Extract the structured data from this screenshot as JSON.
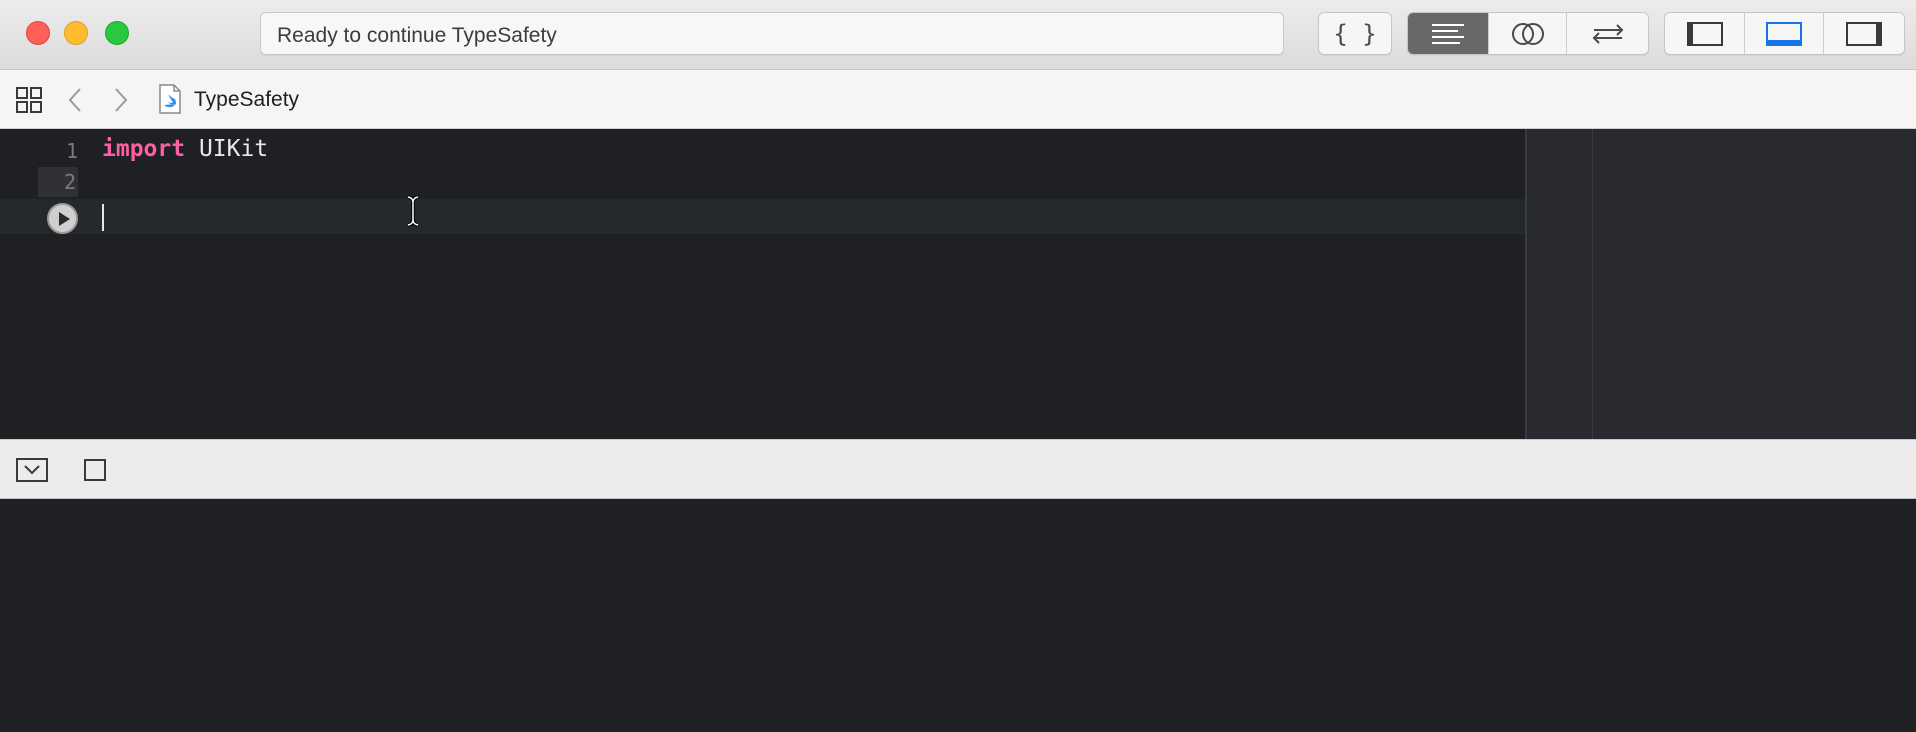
{
  "window": {
    "status_text": "Ready to continue TypeSafety",
    "toolbar": {
      "editor_buttons": [
        {
          "name": "code-snippets-braces",
          "glyph": "{ }"
        },
        {
          "name": "standard-editor",
          "selected": true
        },
        {
          "name": "assistant-editor"
        },
        {
          "name": "version-editor"
        }
      ],
      "view_buttons": [
        {
          "name": "navigator-toggle"
        },
        {
          "name": "debug-area-toggle",
          "active": true
        },
        {
          "name": "utilities-toggle"
        }
      ]
    }
  },
  "jumpbar": {
    "file_name": "TypeSafety",
    "icons": [
      "related-items-grid-icon",
      "back-arrow-icon",
      "forward-arrow-icon",
      "swift-file-icon"
    ]
  },
  "editor": {
    "line_numbers": [
      "1",
      "2"
    ],
    "lines": [
      {
        "keyword": "import",
        "rest": " UIKit"
      },
      {
        "keyword": "",
        "rest": ""
      }
    ]
  },
  "colors": {
    "editor_bg": "#1f2023",
    "keyword": "#fc5fa3",
    "accent": "#1a73e8"
  }
}
